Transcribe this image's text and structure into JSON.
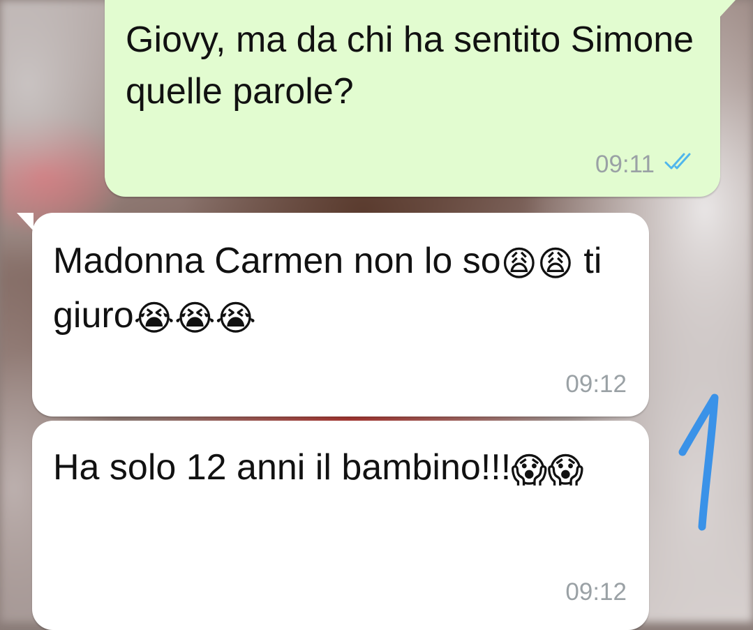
{
  "chat": {
    "messages": [
      {
        "direction": "outgoing",
        "text": "Giovy, ma da chi ha sentito Simone quelle parole?",
        "time": "09:11",
        "status_icon": "double-check-read-icon",
        "status_color": "#4fb6ec"
      },
      {
        "direction": "incoming",
        "text_before": "Madonna Carmen non lo so",
        "emoji_1": "😩😩",
        "text_middle": " ti giuro",
        "emoji_2": "😭😭😭",
        "time": "09:12"
      },
      {
        "direction": "incoming",
        "text_before": "Ha solo 12 anni il bambino!!!",
        "emoji_1": "😱😱",
        "time": "09:12"
      }
    ]
  },
  "annotation": {
    "label": "1",
    "color": "#3a92e8"
  },
  "colors": {
    "outgoing_bubble": "#e2fcd0",
    "incoming_bubble": "#ffffff",
    "timestamp": "#9aa1a5"
  }
}
